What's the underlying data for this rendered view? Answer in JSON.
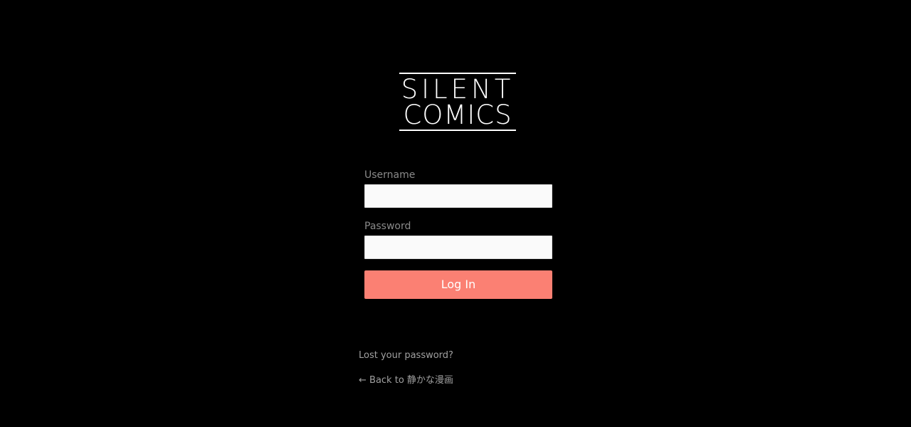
{
  "logo": {
    "line1": "SILENT",
    "line2": "COMICS"
  },
  "form": {
    "username_label": "Username",
    "username_value": "",
    "password_label": "Password",
    "password_value": "",
    "submit_label": "Log In"
  },
  "links": {
    "lost_password": "Lost your password?",
    "back_to_site": "← Back to 静かな漫画"
  },
  "colors": {
    "background": "#000000",
    "button": "#fb8073",
    "label": "#8a8a8a",
    "link": "#a0a0a0",
    "input_background": "#fafafa"
  }
}
